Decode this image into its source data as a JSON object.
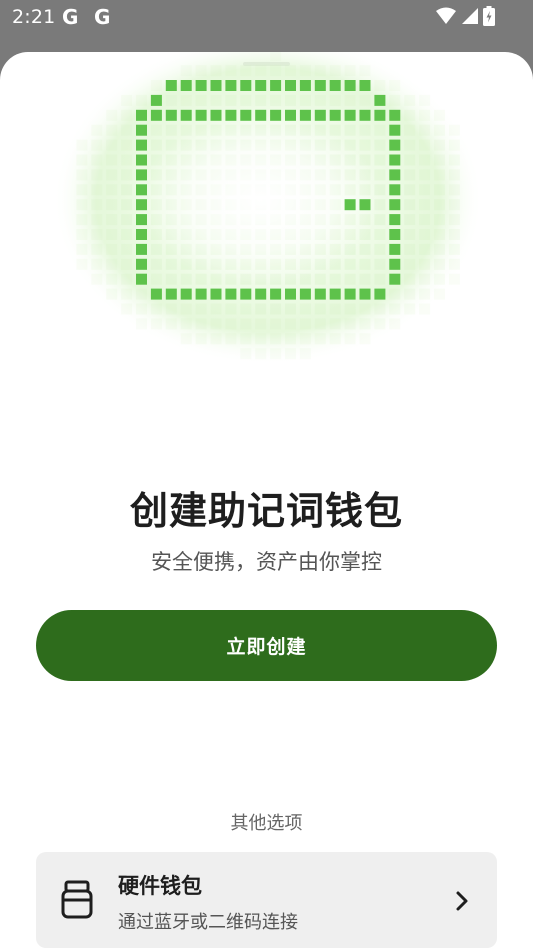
{
  "status_bar": {
    "time": "2:21",
    "g1": "G",
    "g2": "G",
    "icons": [
      "wifi-icon",
      "signal-icon",
      "battery-charging-icon"
    ]
  },
  "illustration": {
    "icon": "pixel-wallet-illustration",
    "accent_color": "#5ec24b",
    "glow_color": "#d9f5c9"
  },
  "main": {
    "title": "创建助记词钱包",
    "subtitle": "安全便携，资产由你掌控",
    "create_button_label": "立即创建",
    "button_color": "#2e6c1c"
  },
  "other": {
    "section_label": "其他选项",
    "hardware": {
      "icon": "hardware-wallet-icon",
      "title": "硬件钱包",
      "subtitle": "通过蓝牙或二维码连接",
      "chevron": "chevron-right-icon"
    }
  }
}
